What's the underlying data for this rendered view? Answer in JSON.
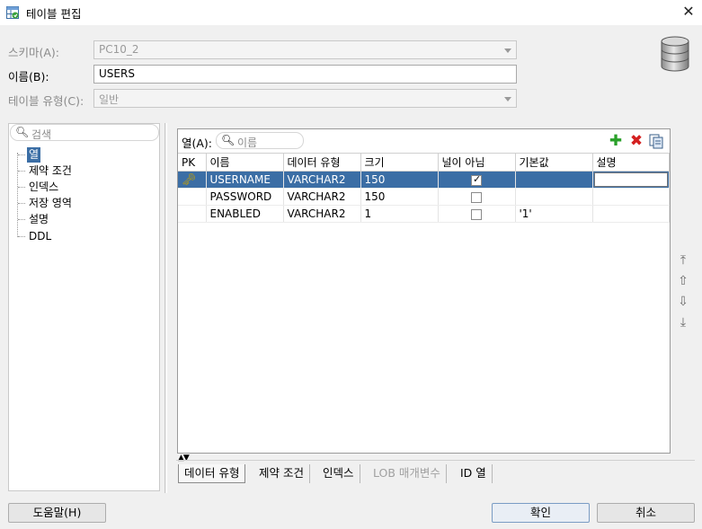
{
  "window": {
    "title": "테이블 편집"
  },
  "form": {
    "schema_label": "스키마(A):",
    "schema_value": "PC10_2",
    "name_label": "이름(B):",
    "name_value": "USERS",
    "table_type_label": "테이블 유형(C):",
    "table_type_value": "일반"
  },
  "left_panel": {
    "search_placeholder": "검색",
    "items": [
      "열",
      "제약 조건",
      "인덱스",
      "저장 영역",
      "설명",
      "DDL"
    ],
    "selected": "열"
  },
  "columns_panel": {
    "label": "열(A):",
    "search_placeholder": "이름",
    "headers": [
      "PK",
      "이름",
      "데이터 유형",
      "크기",
      "널이 아님",
      "기본값",
      "설명"
    ],
    "rows": [
      {
        "pk": true,
        "name": "USERNAME",
        "type": "VARCHAR2",
        "size": "150",
        "not_null": true,
        "default": "",
        "desc": ""
      },
      {
        "pk": false,
        "name": "PASSWORD",
        "type": "VARCHAR2",
        "size": "150",
        "not_null": false,
        "default": "",
        "desc": ""
      },
      {
        "pk": false,
        "name": "ENABLED",
        "type": "VARCHAR2",
        "size": "1",
        "not_null": false,
        "default": "'1'",
        "desc": ""
      }
    ]
  },
  "bottom_tabs": [
    "데이터 유형",
    "제약 조건",
    "인덱스",
    "LOB 매개변수",
    "ID 열"
  ],
  "buttons": {
    "help": "도움말(H)",
    "ok": "확인",
    "cancel": "취소"
  },
  "colors": {
    "selection": "#3b6ea5",
    "add": "#2aa02a",
    "delete": "#d42020"
  },
  "icons": [
    "table-edit-icon",
    "close-icon",
    "database-icon",
    "search-icon",
    "add-icon",
    "delete-icon",
    "copy-icon",
    "key-icon",
    "move-top-icon",
    "move-up-icon",
    "move-down-icon",
    "move-bottom-icon"
  ]
}
